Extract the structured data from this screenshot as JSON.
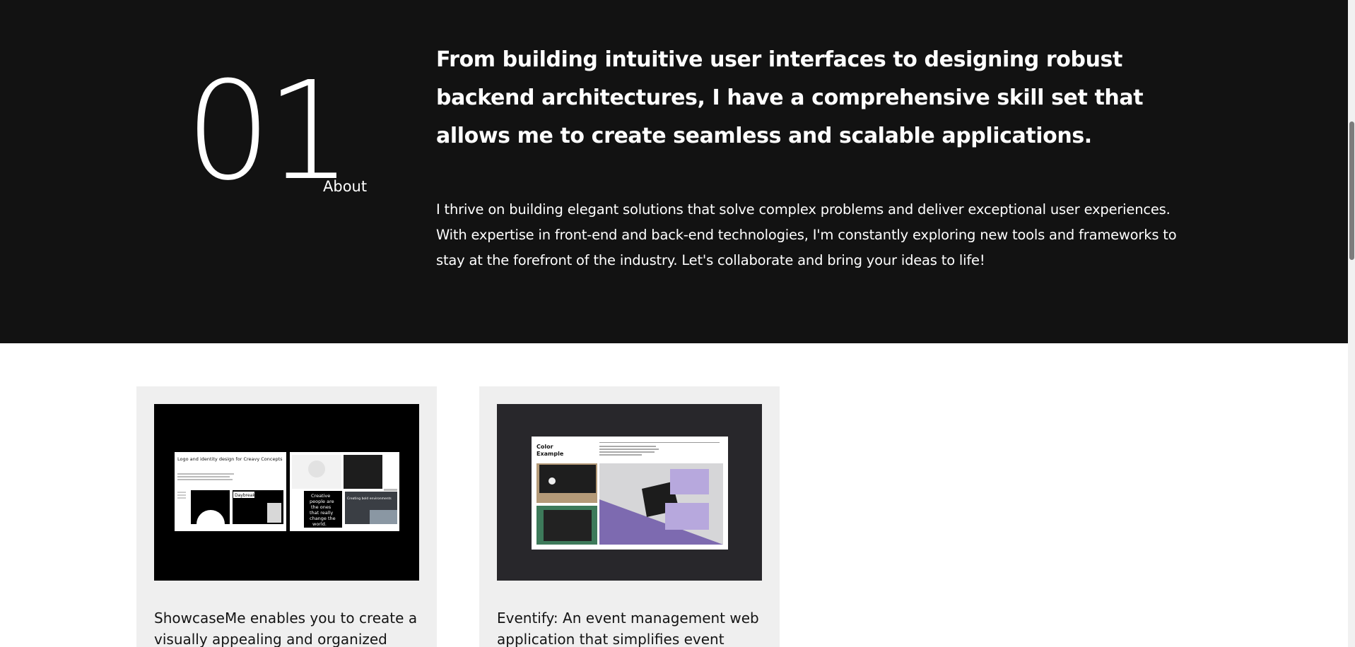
{
  "about": {
    "number": "01",
    "label": "About",
    "headline": "From building intuitive user interfaces to designing robust backend architectures, I have a comprehensive skill set that allows me to create seamless and scalable applications.",
    "body": "I thrive on building elegant solutions that solve complex problems and deliver exceptional user experiences. With expertise in front-end and back-end technologies, I'm constantly exploring new tools and frameworks to stay at the forefront of the industry. Let's collaborate and bring your ideas to life!"
  },
  "projects": [
    {
      "description": "ShowcaseMe enables you to create a visually appealing and organized",
      "thumbnail": {
        "heading": "Logo and identity design for Creavy Concepts",
        "tag": "Daybreak",
        "quote_lines": [
          "Creative",
          "people are",
          "the ones",
          "that really",
          "change the",
          "world."
        ],
        "side_text": "Creating bold environments"
      }
    },
    {
      "description": "Eventify: An event management web application that simplifies event",
      "thumbnail": {
        "heading_line1": "Color",
        "heading_line2": "Example"
      }
    }
  ],
  "colors": {
    "dark_section": "#121212",
    "card_background": "#efefef",
    "accent_purple": "#7d6ab0"
  }
}
